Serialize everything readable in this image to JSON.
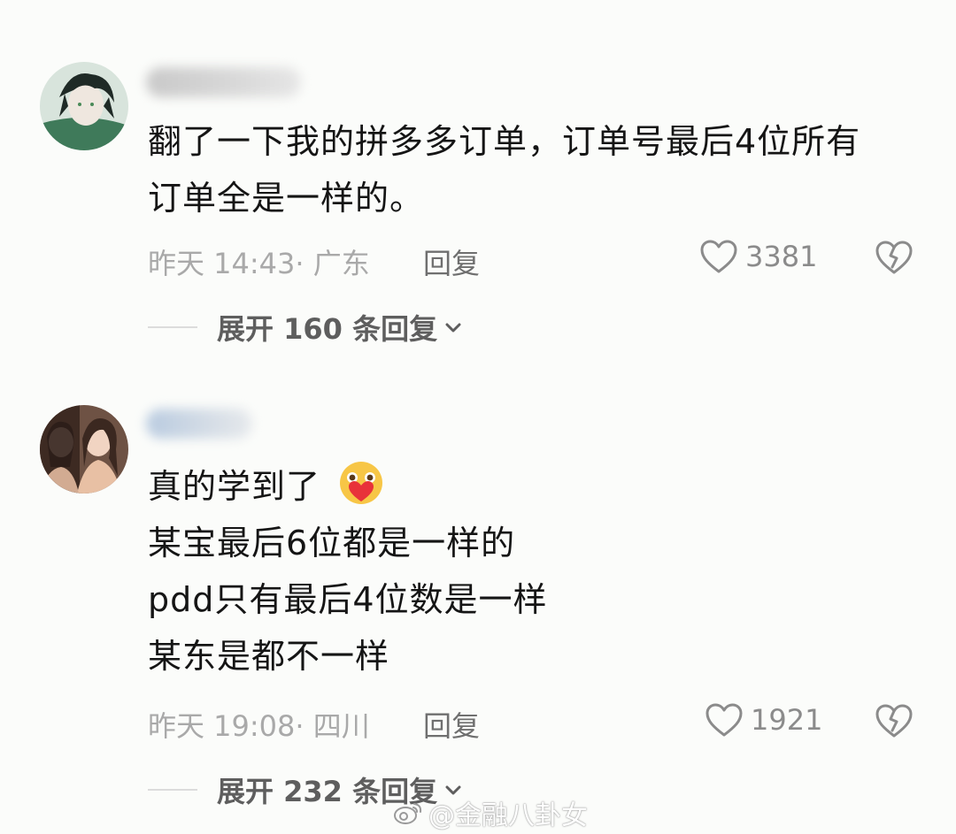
{
  "comments": [
    {
      "text_lines": [
        "翻了一下我的拼多多订单，订单号最后4位所有",
        "订单全是一样的。"
      ],
      "meta": "昨天 14:43· 广东",
      "reply_label": "回复",
      "likes": "3381",
      "expand_label": "展开 160 条回复"
    },
    {
      "text_lines": [
        "真的学到了",
        "某宝最后6位都是一样的",
        "pdd只有最后4位数是一样",
        "某东是都不一样"
      ],
      "meta": "昨天 19:08· 四川",
      "reply_label": "回复",
      "likes": "1921",
      "expand_label": "展开 232 条回复"
    }
  ],
  "watermark": "@金融八卦女"
}
